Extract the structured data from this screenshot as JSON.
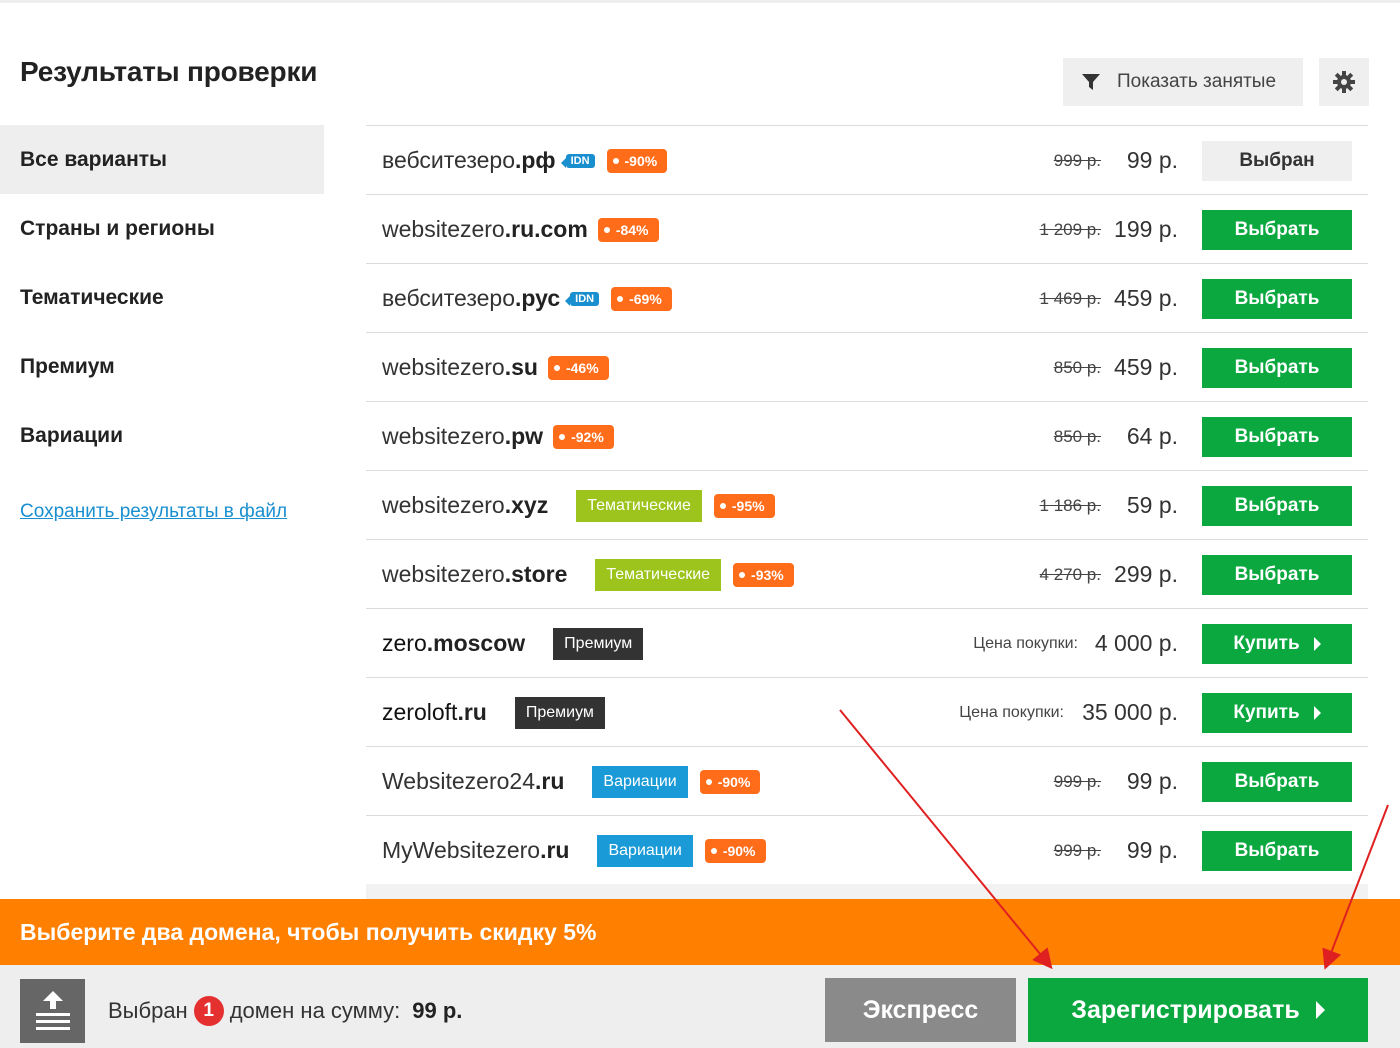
{
  "title": "Результаты проверки",
  "toolbar": {
    "show_busy_label": "Показать занятые"
  },
  "sidebar": {
    "items": [
      {
        "label": "Все варианты"
      },
      {
        "label": "Страны и регионы"
      },
      {
        "label": "Тематические"
      },
      {
        "label": "Премиум"
      },
      {
        "label": "Вариации"
      }
    ],
    "save_link": "Сохранить результаты в файл"
  },
  "domains": [
    {
      "name": "вебситезеро",
      "zone": ".рф",
      "idn": "IDN",
      "discount": "-90%",
      "old_price": "999 р.",
      "price": "99 р.",
      "action": "Выбран"
    },
    {
      "name": "websitezero",
      "zone": ".ru.com",
      "discount": "-84%",
      "old_price": "1 209 р.",
      "price": "199 р.",
      "action": "Выбрать"
    },
    {
      "name": "вебситезеро",
      "zone": ".рус",
      "idn": "IDN",
      "discount": "-69%",
      "old_price": "1 469 р.",
      "price": "459 р.",
      "action": "Выбрать"
    },
    {
      "name": "websitezero",
      "zone": ".su",
      "discount": "-46%",
      "old_price": "850 р.",
      "price": "459 р.",
      "action": "Выбрать"
    },
    {
      "name": "websitezero",
      "zone": ".pw",
      "discount": "-92%",
      "old_price": "850 р.",
      "price": "64 р.",
      "action": "Выбрать"
    },
    {
      "name": "websitezero",
      "zone": ".xyz",
      "category": "Тематические",
      "discount": "-95%",
      "old_price": "1 186 р.",
      "price": "59 р.",
      "action": "Выбрать"
    },
    {
      "name": "websitezero",
      "zone": ".store",
      "category": "Тематические",
      "discount": "-93%",
      "old_price": "4 270 р.",
      "price": "299 р.",
      "action": "Выбрать"
    },
    {
      "name": "zero",
      "zone": ".moscow",
      "category": "Премиум",
      "buy_label": "Цена покупки:",
      "price": "4 000 р.",
      "action": "Купить"
    },
    {
      "name": "zeroloft",
      "zone": ".ru",
      "category": "Премиум",
      "buy_label": "Цена покупки:",
      "price": "35 000 р.",
      "action": "Купить"
    },
    {
      "name": "Websitezero24",
      "zone": ".ru",
      "category": "Вариации",
      "discount": "-90%",
      "old_price": "999 р.",
      "price": "99 р.",
      "action": "Выбрать"
    },
    {
      "name": "MyWebsitezero",
      "zone": ".ru",
      "category": "Вариации",
      "discount": "-90%",
      "old_price": "999 р.",
      "price": "99 р.",
      "action": "Выбрать"
    }
  ],
  "promo": "Выберите два домена, чтобы получить скидку 5%",
  "bottom": {
    "selected_prefix": "Выбран",
    "selected_count": "1",
    "selected_suffix": "домен на сумму:",
    "sum": "99 р.",
    "express_label": "Экспресс",
    "register_label": "Зарегистрировать"
  },
  "colors": {
    "green": "#0aa83f",
    "orange": "#ff7f00",
    "discount": "#ff6d1b",
    "theme_tag": "#9dc41c",
    "premium_tag": "#333333",
    "variation_tag": "#1a9ad6",
    "idn": "#1a8fd0",
    "annotation_arrow": "#e02020"
  }
}
